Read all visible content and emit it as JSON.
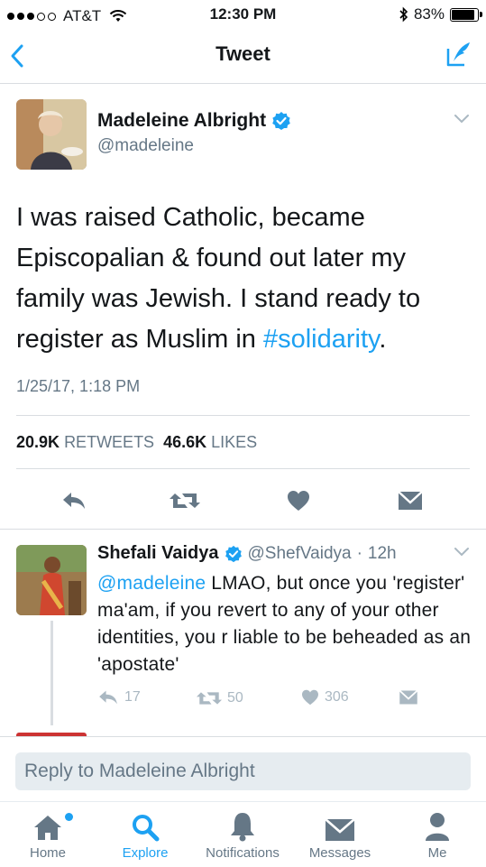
{
  "status_bar": {
    "carrier": "AT&T",
    "time": "12:30 PM",
    "battery": "83%",
    "battery_level": 0.83
  },
  "nav": {
    "title": "Tweet"
  },
  "tweet": {
    "author_name": "Madeleine Albright",
    "author_handle": "@madeleine",
    "text_before": "I was raised Catholic, became Episcopalian & found out later my family was Jewish. I stand ready to register as Muslim in ",
    "hashtag": "#solidarity",
    "text_after": ".",
    "timestamp": "1/25/17, 1:18 PM",
    "retweet_count": "20.9K",
    "retweets_label": "RETWEETS",
    "like_count": "46.6K",
    "likes_label": "LIKES"
  },
  "reply": {
    "author_name": "Shefali Vaidya",
    "author_handle": "@ShefVaidya",
    "separator": "·",
    "age": "12h",
    "mention": "@madeleine",
    "text": " LMAO, but once you 'register' ma'am, if you revert to any of your other identities, you r liable to be beheaded as an 'apostate'",
    "reply_count": "17",
    "retweet_count": "50",
    "like_count": "306"
  },
  "reply_box": {
    "placeholder": "Reply to Madeleine Albright"
  },
  "tabs": [
    {
      "label": "Home",
      "icon": "home-icon"
    },
    {
      "label": "Explore",
      "icon": "search-icon"
    },
    {
      "label": "Notifications",
      "icon": "bell-icon"
    },
    {
      "label": "Messages",
      "icon": "envelope-icon"
    },
    {
      "label": "Me",
      "icon": "person-icon"
    }
  ],
  "colors": {
    "accent": "#1da1f2",
    "text": "#14171a",
    "muted": "#657786",
    "icon_muted": "#aab8c2"
  }
}
